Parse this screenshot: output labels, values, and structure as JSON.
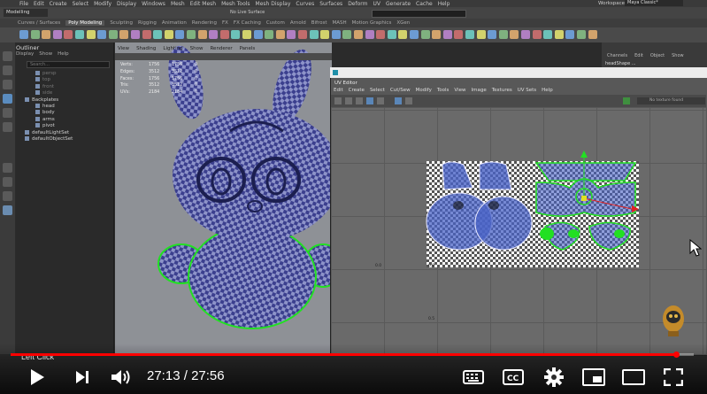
{
  "menu": {
    "items": [
      "File",
      "Edit",
      "Create",
      "Select",
      "Modify",
      "Display",
      "Windows",
      "Mesh",
      "Edit Mesh",
      "Mesh Tools",
      "Mesh Display",
      "Curves",
      "Surfaces",
      "Deform",
      "UV",
      "Generate",
      "Cache",
      "Help"
    ],
    "workspace_label": "Workspace:",
    "workspace_value": "Maya Classic*"
  },
  "status_line": {
    "mode": "Modelling",
    "surface_label": "No Live Surface"
  },
  "shelf": {
    "tabs": [
      "Curves / Surfaces",
      "Poly Modeling",
      "Sculpting",
      "Rigging",
      "Animation",
      "Rendering",
      "FX",
      "FX Caching",
      "Custom",
      "Arnold",
      "Bifrost",
      "MASH",
      "Motion Graphics",
      "XGen"
    ],
    "active_tab": "Poly Modeling"
  },
  "outliner": {
    "title": "Outliner",
    "menu": [
      "Display",
      "Show",
      "Help"
    ],
    "search_placeholder": "Search...",
    "items": [
      {
        "label": "persp",
        "child": true,
        "dim": true
      },
      {
        "label": "top",
        "child": true,
        "dim": true
      },
      {
        "label": "front",
        "child": true,
        "dim": true
      },
      {
        "label": "side",
        "child": true,
        "dim": true
      },
      {
        "label": "Backplates",
        "child": false,
        "dim": false
      },
      {
        "label": "head",
        "child": true,
        "dim": false
      },
      {
        "label": "body",
        "child": true,
        "dim": false
      },
      {
        "label": "arms",
        "child": true,
        "dim": false
      },
      {
        "label": "pivot",
        "child": true,
        "dim": false
      },
      {
        "label": "defaultLightSet",
        "child": false,
        "dim": false
      },
      {
        "label": "defaultObjectSet",
        "child": false,
        "dim": false
      }
    ]
  },
  "viewport": {
    "menu": [
      "View",
      "Shading",
      "Lighting",
      "Show",
      "Renderer",
      "Panels"
    ],
    "hud": [
      {
        "label": "Verts:",
        "v1": "1756",
        "v2": "1756",
        "v3": "0"
      },
      {
        "label": "Edges:",
        "v1": "3512",
        "v2": "3512",
        "v3": "0"
      },
      {
        "label": "Faces:",
        "v1": "1756",
        "v2": "1756",
        "v3": "0"
      },
      {
        "label": "Tris:",
        "v1": "3512",
        "v2": "3512",
        "v3": "0"
      },
      {
        "label": "UVs:",
        "v1": "2184",
        "v2": "2184",
        "v3": "0"
      }
    ]
  },
  "channel_box": {
    "menu": [
      "Channels",
      "Edit",
      "Object",
      "Show"
    ],
    "selection": "headShape ..."
  },
  "uv_editor": {
    "title": "UV Editor",
    "menu": [
      "Edit",
      "Create",
      "Select",
      "Cut/Sew",
      "Modify",
      "Tools",
      "View",
      "Image",
      "Textures",
      "UV Sets",
      "Help"
    ],
    "filter_placeholder": "No texture found",
    "tick_labels": {
      "zero_x": "0.0",
      "zero_y": "0.0",
      "half": "0.5"
    }
  },
  "video_overlay": {
    "caption": "Left Click",
    "current_time": "27:13",
    "duration": "27:56",
    "progress": 0.9743,
    "colors": {
      "progress": "#ff0000",
      "text": "#ffffff"
    }
  }
}
